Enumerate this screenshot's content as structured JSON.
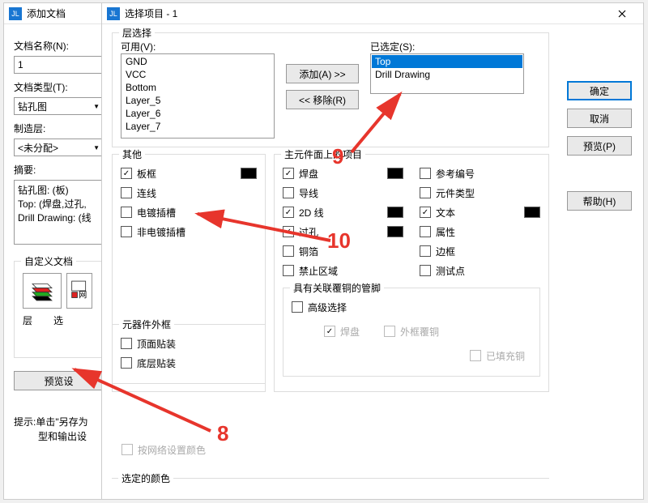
{
  "window_add": {
    "title": "添加文档",
    "doc_name_label": "文档名称(N):",
    "doc_name_value": "1",
    "doc_type_label": "文档类型(T):",
    "doc_type_value": "钻孔图",
    "mfg_layer_label": "制造层:",
    "mfg_layer_value": "<未分配>",
    "summary_label": "摘要:",
    "summary_lines": [
      "钻孔图: (板)",
      "Top: (焊盘,过孔,",
      "Drill Drawing: (线"
    ],
    "custom_doc_label": "自定义文档",
    "layer_label": "层",
    "select_label": "选",
    "preview_btn": "预览设",
    "tip_line1": "提示:单击\"另存为",
    "tip_line2": "型和输出设"
  },
  "window_sel": {
    "title": "选择项目 - 1",
    "layer_select_group": "层选择",
    "available_label": "可用(V):",
    "available_items": [
      "GND",
      "VCC",
      "Bottom",
      "Layer_5",
      "Layer_6",
      "Layer_7"
    ],
    "add_btn": "添加(A) >>",
    "remove_btn": "<< 移除(R)",
    "selected_label": "已选定(S):",
    "selected_items": [
      "Top",
      "Drill Drawing"
    ],
    "other_group": "其他",
    "other": {
      "board_outline": "板框",
      "connections": "连线",
      "plated_slots": "电镀插槽",
      "nonplated_slots": "非电镀插槽"
    },
    "part_group": "元器件外框",
    "part": {
      "top_assembly": "顶面贴装",
      "bottom_assembly": "底层贴装"
    },
    "main_group": "主元件面上的项目",
    "main": {
      "pad": "焊盘",
      "trace": "导线",
      "line2d": "2D 线",
      "via": "过孔",
      "copper": "铜箔",
      "keepout": "禁止区域",
      "ref": "参考编号",
      "parttype": "元件类型",
      "text": "文本",
      "attr": "属性",
      "edge": "边框",
      "testpoint": "测试点"
    },
    "assoc_group": "具有关联覆铜的管脚",
    "adv_select": "高级选择",
    "adv_pad": "焊盘",
    "adv_outer": "外框覆铜",
    "adv_filled": "已填充铜",
    "bycolor_label": "按网络设置颜色",
    "selected_color_group": "选定的颜色",
    "buttons": {
      "ok": "确定",
      "cancel": "取消",
      "preview": "预览(P)",
      "help": "帮助(H)"
    }
  },
  "annotations": {
    "n8": "8",
    "n9": "9",
    "n10": "10"
  },
  "colors": {
    "accent": "#0078d7",
    "annotation": "#e7352c"
  }
}
